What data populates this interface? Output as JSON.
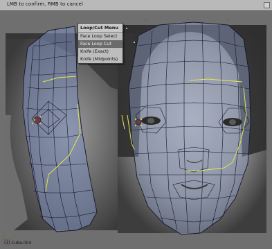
{
  "header": {
    "hint": "LMB to confirm, RMB to cancel"
  },
  "menu": {
    "title": "Loop/Cut Menu",
    "items": [
      {
        "label": "Face Loop Select",
        "active": false
      },
      {
        "label": "Face Loop Cut",
        "active": true
      },
      {
        "label": "Knife (Exact)",
        "active": false
      },
      {
        "label": "Knife (Midpoints)",
        "active": false
      }
    ]
  },
  "status": {
    "object_name": "(1) Cube.004"
  },
  "colors": {
    "mesh_edge": "#1a1a2e",
    "mesh_face": "#8fa0c8",
    "seam": "#e8e650",
    "header_bg": "#b9b9b9",
    "menu_active": "#6c6c6c"
  }
}
